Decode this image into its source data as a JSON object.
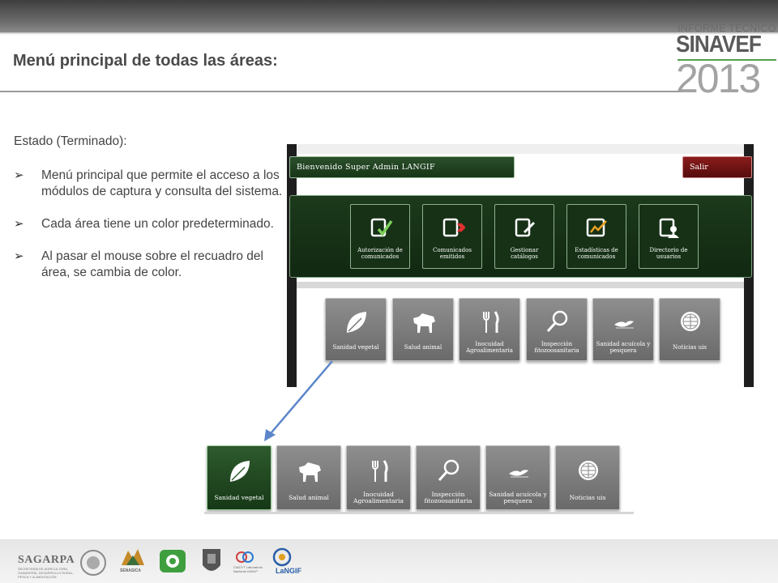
{
  "slide": {
    "title": "Menú principal de todas las áreas:"
  },
  "brand": {
    "caption": "INFORME TECNICO",
    "name": "SINAVEF",
    "year": "2013"
  },
  "content": {
    "status": "Estado (Terminado):",
    "bullets": [
      "Menú principal que permite el acceso a los módulos de captura y consulta del sistema.",
      "Cada área tiene un color predeterminado.",
      "Al pasar el mouse sobre el recuadro del área, se cambia de color."
    ]
  },
  "app": {
    "welcome": "Bienvenido Super Admin LANGIF",
    "exit": "Salir",
    "admin_tiles": [
      {
        "label": "Autorización de comunicados",
        "icon": "doc-check-icon"
      },
      {
        "label": "Comunicados emitidos",
        "icon": "doc-send-icon"
      },
      {
        "label": "Gestionar catálogos",
        "icon": "doc-edit-icon"
      },
      {
        "label": "Estadísticas de comunicados",
        "icon": "chart-icon"
      },
      {
        "label": "Directorio de usuarios",
        "icon": "users-doc-icon"
      }
    ],
    "area_tiles": [
      {
        "label": "Sanidad vegetal",
        "icon": "leaf-icon"
      },
      {
        "label": "Salud animal",
        "icon": "bull-icon"
      },
      {
        "label": "Inocuidad Agroalimentaria",
        "icon": "fork-knife-icon"
      },
      {
        "label": "Inspección fitozoosanitaria",
        "icon": "magnifier-icon"
      },
      {
        "label": "Sanidad acuícola y pesquera",
        "icon": "bird-icon"
      },
      {
        "label": "Noticias uis",
        "icon": "globe-icon"
      }
    ]
  },
  "footer": {
    "sagarpa": "SAGARPA",
    "sagarpa_sub": "SECRETARÍA DE AGRICULTURA, GANADERÍA, DESARROLLO RURAL, PESCA Y ALIMENTACIÓN",
    "senasica": "SENASICA",
    "conacyt": "CIACYT Laboratorio Nacional UASLP",
    "langif": "LaNGIF"
  },
  "colors": {
    "admin_green": "#1c3a1c",
    "tile_gray": "#7a7a7a",
    "active_green": "#2e5a2e",
    "exit_red": "#7a1616",
    "arrow_blue": "#5b86c9"
  }
}
